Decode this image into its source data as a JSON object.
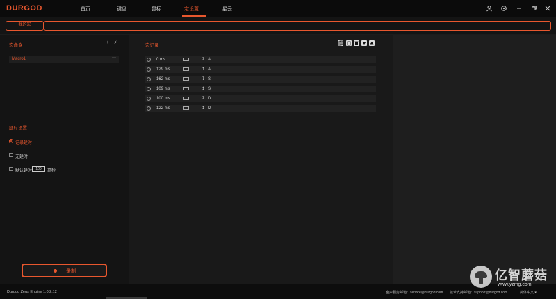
{
  "app": {
    "logo": "DURGOD",
    "nav": [
      "首页",
      "键盘",
      "鼠标",
      "宏设置",
      "星云"
    ],
    "active_nav_index": 3,
    "window_icons": [
      "user-icon",
      "settings-icon",
      "minimize-icon",
      "maximize-icon",
      "close-icon"
    ]
  },
  "subbar": {
    "tab_mine": "我的宏"
  },
  "left": {
    "macro_title": "宏命令",
    "add_symbol": "+",
    "flash_symbol": "⚡",
    "macros": [
      {
        "name": "Macro1",
        "more": "···"
      }
    ],
    "delay_title": "延时设置",
    "options": {
      "record_delay": "记录延时",
      "no_delay": "无延时",
      "default_delay": "默认延时",
      "default_delay_value": "100",
      "unit": "毫秒"
    },
    "record_button": "录制"
  },
  "center": {
    "title": "宏记录",
    "records": [
      {
        "delay": "0 ms",
        "dir": "↧",
        "key": "A"
      },
      {
        "delay": "129 ms",
        "dir": "↥",
        "key": "A"
      },
      {
        "delay": "162 ms",
        "dir": "↧",
        "key": "S"
      },
      {
        "delay": "109 ms",
        "dir": "↥",
        "key": "S"
      },
      {
        "delay": "100 ms",
        "dir": "↧",
        "key": "D"
      },
      {
        "delay": "122 ms",
        "dir": "↥",
        "key": "D"
      }
    ]
  },
  "footer": {
    "version": "Durgod Zeus Engine 1.0.2.12",
    "service": "客户服务邮箱：service@durgod.com",
    "support": "技术支持邮箱：support@durgod.com",
    "language": "简体中文 ▾"
  },
  "watermark": {
    "cn": "亿智蘑菇",
    "url": "www.yzmg.com"
  },
  "colors": {
    "accent": "#e8572e",
    "bg": "#121212"
  }
}
